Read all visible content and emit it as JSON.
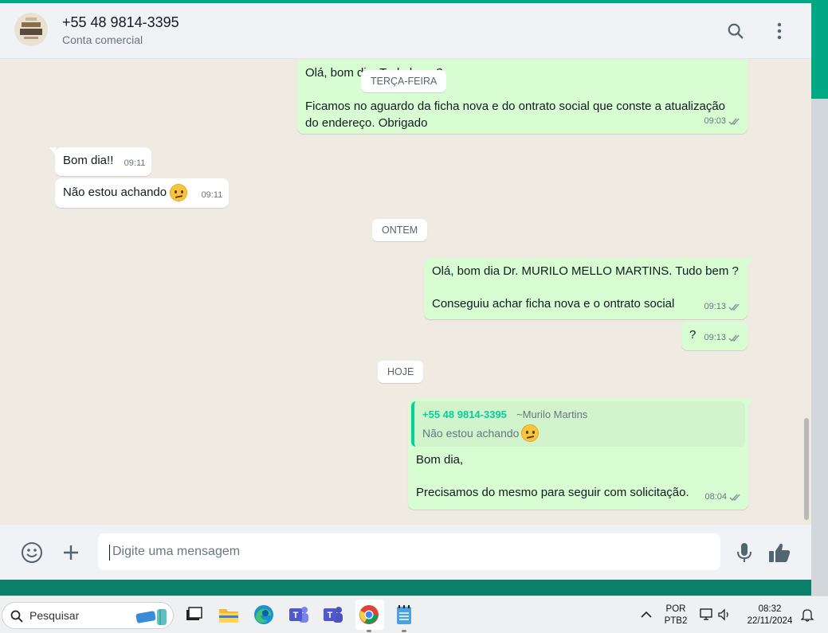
{
  "colors": {
    "accent": "#00a884",
    "outgoing_bubble": "#d9fdd3",
    "incoming_bubble": "#ffffff",
    "chat_background": "#efeae2",
    "read_ticks": "#53bdeb"
  },
  "header": {
    "contact_name": "+55 48 9814-3395",
    "contact_subtitle": "Conta comercial",
    "search_icon": "search-icon",
    "menu_icon": "menu-dots-icon"
  },
  "messages": {
    "m1": {
      "text": "Olá, bom dia. Tudo bem ?"
    },
    "sep_tuesday": "TERÇA-FEIRA",
    "m2": {
      "text": "Ficamos no aguardo da ficha nova e do ontrato social que conste a atualização do endereço. Obrigado",
      "time": "09:03"
    },
    "m3": {
      "text": "Bom dia!!",
      "time": "09:11"
    },
    "m4": {
      "text": "Não estou achando",
      "time": "09:11"
    },
    "sep_yesterday": "ONTEM",
    "m5": {
      "line1": "Olá, bom dia Dr. MURILO MELLO MARTINS. Tudo bem ?",
      "line2": "Conseguiu achar ficha nova e o ontrato social",
      "time": "09:13"
    },
    "m6": {
      "text": "?",
      "time": "09:13"
    },
    "sep_today": "HOJE",
    "m7": {
      "quote_author": "+55 48 9814-3395",
      "quote_name": "~Murilo Martins",
      "quote_text": "Não estou achando",
      "line1": "Bom dia,",
      "line2": "Precisamos do mesmo para seguir com solicitação.",
      "time": "08:04"
    }
  },
  "composer": {
    "placeholder": "Digite uma mensagem",
    "emoji_icon": "emoji-icon",
    "attach_icon": "plus-icon",
    "mic_icon": "mic-icon",
    "like_icon": "thumbs-up-icon"
  },
  "taskbar": {
    "search_label": "Pesquisar",
    "language_line1": "POR",
    "language_line2": "PTB2",
    "time": "08:32",
    "date": "22/11/2024"
  }
}
